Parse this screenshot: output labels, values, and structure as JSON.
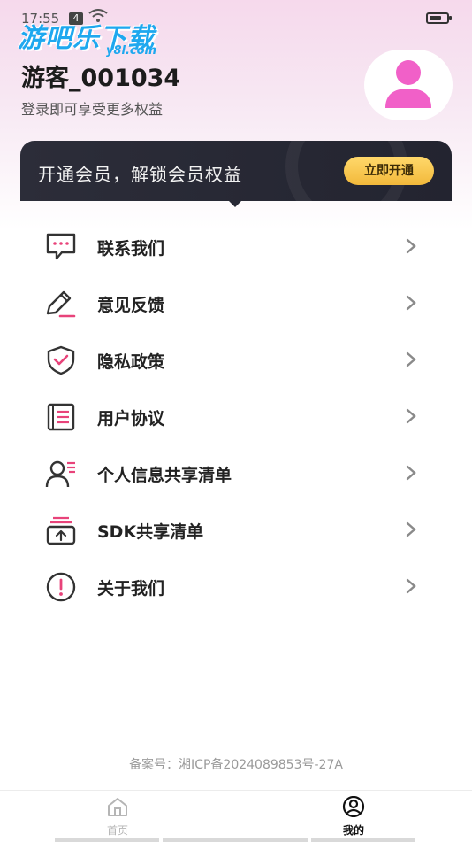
{
  "status_bar": {
    "time": "17:55",
    "sim": "4",
    "wifi": "wifi-icon",
    "battery_level": 0.7
  },
  "watermark": {
    "text": "游吧乐下载",
    "sub": "y8l.com"
  },
  "profile": {
    "username": "游客_001034",
    "subtitle": "登录即可享受更多权益",
    "avatar_icon": "user-avatar-icon",
    "avatar_color": "#f160c8"
  },
  "vip": {
    "text": "开通会员，解锁会员权益",
    "button": "立即开通",
    "accent": "#f5c04a"
  },
  "menu": {
    "items": [
      {
        "label": "联系我们",
        "icon": "chat-bubble-icon"
      },
      {
        "label": "意见反馈",
        "icon": "pencil-icon"
      },
      {
        "label": "隐私政策",
        "icon": "shield-check-icon"
      },
      {
        "label": "用户协议",
        "icon": "document-icon"
      },
      {
        "label": "个人信息共享清单",
        "icon": "person-list-icon"
      },
      {
        "label": "SDK共享清单",
        "icon": "share-box-icon"
      },
      {
        "label": "关于我们",
        "icon": "info-circle-icon"
      }
    ]
  },
  "footer": {
    "icp": "备案号：湘ICP备2024089853号-27A"
  },
  "tabbar": {
    "tabs": [
      {
        "label": "首页",
        "icon": "home-icon",
        "active": false
      },
      {
        "label": "我的",
        "icon": "profile-icon",
        "active": true
      }
    ]
  },
  "colors": {
    "accent_pink": "#e8437a",
    "dark_card": "#2a2b36"
  }
}
